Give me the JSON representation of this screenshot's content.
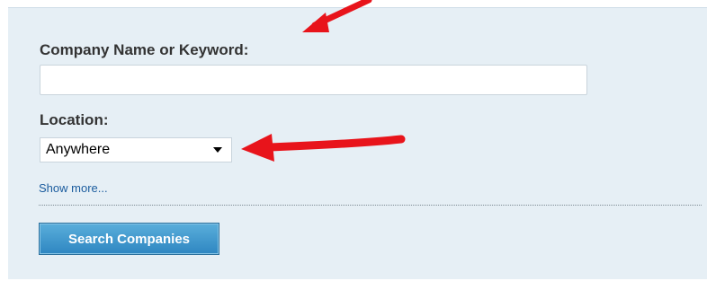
{
  "form": {
    "company_label": "Company Name or Keyword:",
    "company_value": "",
    "company_placeholder": "",
    "location_label": "Location:",
    "location_selected": "Anywhere",
    "show_more_label": "Show more...",
    "search_button_label": "Search Companies"
  },
  "annotations": {
    "arrow_color": "#e8141b"
  },
  "colors": {
    "panel_background": "#e6eff5",
    "link": "#1b5c9e",
    "button": "#3a92cc"
  }
}
